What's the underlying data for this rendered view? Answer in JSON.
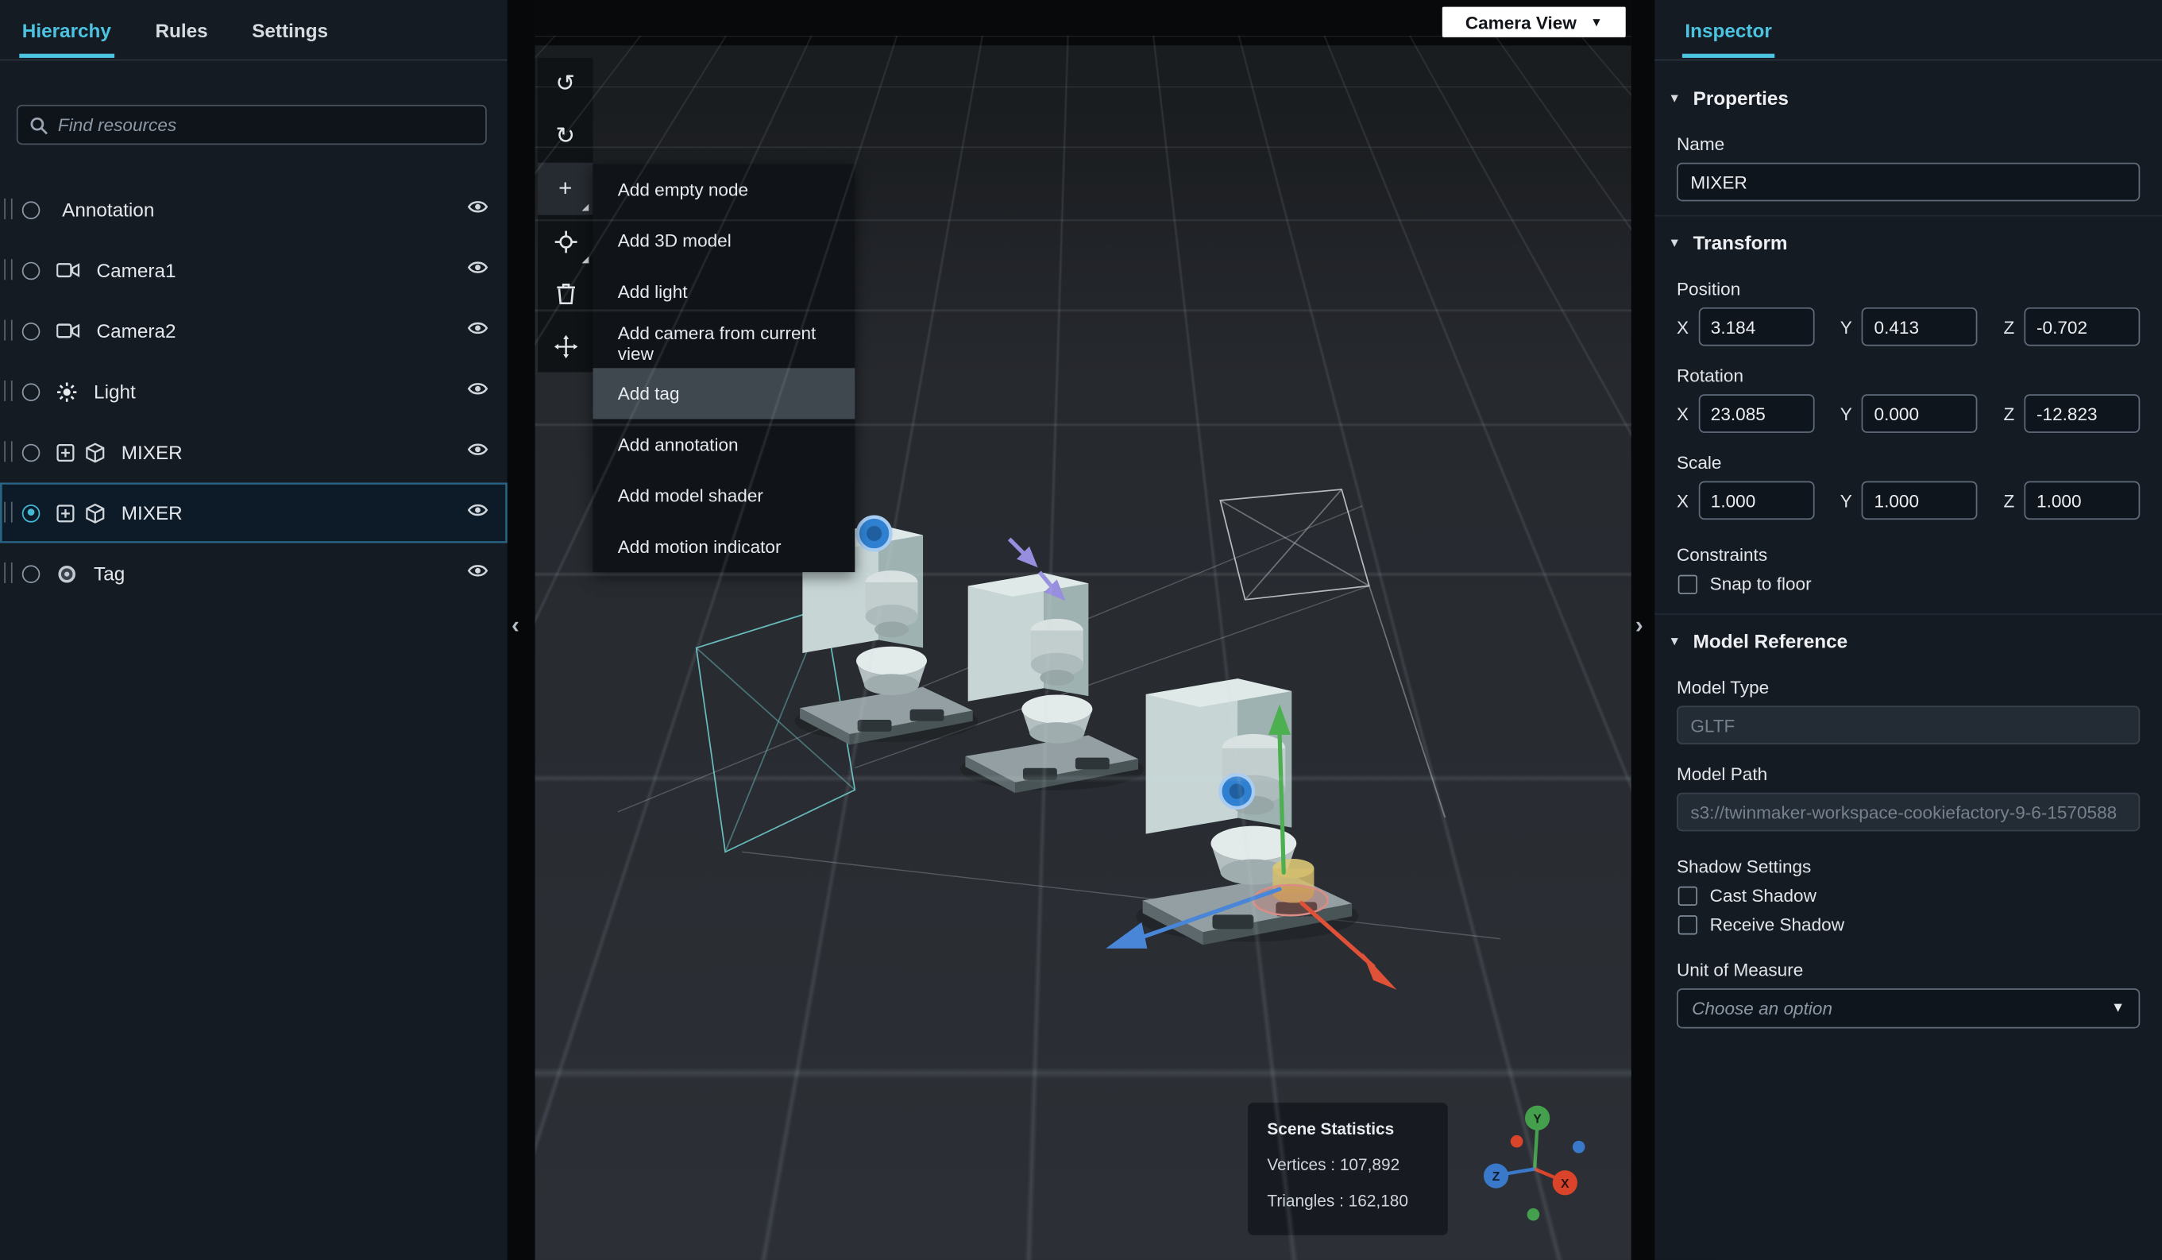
{
  "icons": {
    "chevron_down": "▼",
    "triangle_down": "▼",
    "chevron_left": "‹",
    "chevron_right": "›",
    "undo": "↺",
    "redo": "↻",
    "plus": "+"
  },
  "axis": {
    "x": "X",
    "y": "Y",
    "z": "Z"
  },
  "sidebar": {
    "tabs": [
      "Hierarchy",
      "Rules",
      "Settings"
    ],
    "search_placeholder": "Find resources",
    "items": [
      {
        "label": "Annotation",
        "icon": "none"
      },
      {
        "label": "Camera1",
        "icon": "camera"
      },
      {
        "label": "Camera2",
        "icon": "camera"
      },
      {
        "label": "Light",
        "icon": "light"
      },
      {
        "label": "MIXER",
        "icon": "model"
      },
      {
        "label": "MIXER",
        "icon": "model",
        "selected": true
      },
      {
        "label": "Tag",
        "icon": "tag"
      }
    ]
  },
  "canvas": {
    "camera_view_label": "Camera View",
    "menu": {
      "items": [
        "Add empty node",
        "Add 3D model",
        "Add light",
        "Add camera from current view",
        "Add tag",
        "Add annotation",
        "Add model shader",
        "Add motion indicator"
      ],
      "highlighted": "Add tag"
    },
    "scene_stats": {
      "title": "Scene Statistics",
      "vertices": "Vertices : 107,892",
      "triangles": "Triangles : 162,180"
    }
  },
  "inspector": {
    "tab": "Inspector",
    "properties": {
      "title": "Properties",
      "name_label": "Name",
      "name_value": "MIXER"
    },
    "transform": {
      "title": "Transform",
      "position": {
        "label": "Position",
        "x": "3.184",
        "y": "0.413",
        "z": "-0.702"
      },
      "rotation": {
        "label": "Rotation",
        "x": "23.085",
        "y": "0.000",
        "z": "-12.823"
      },
      "scale": {
        "label": "Scale",
        "x": "1.000",
        "y": "1.000",
        "z": "1.000"
      },
      "constraints_label": "Constraints",
      "snap_to_floor_label": "Snap to floor"
    },
    "model_reference": {
      "title": "Model Reference",
      "model_type_label": "Model Type",
      "model_type_value": "GLTF",
      "model_path_label": "Model Path",
      "model_path_value": "s3://twinmaker-workspace-cookiefactory-9-6-1570588",
      "shadow_settings_label": "Shadow Settings",
      "cast_shadow_label": "Cast Shadow",
      "receive_shadow_label": "Receive Shadow",
      "unit_of_measure_label": "Unit of Measure",
      "unit_placeholder": "Choose an option"
    }
  }
}
